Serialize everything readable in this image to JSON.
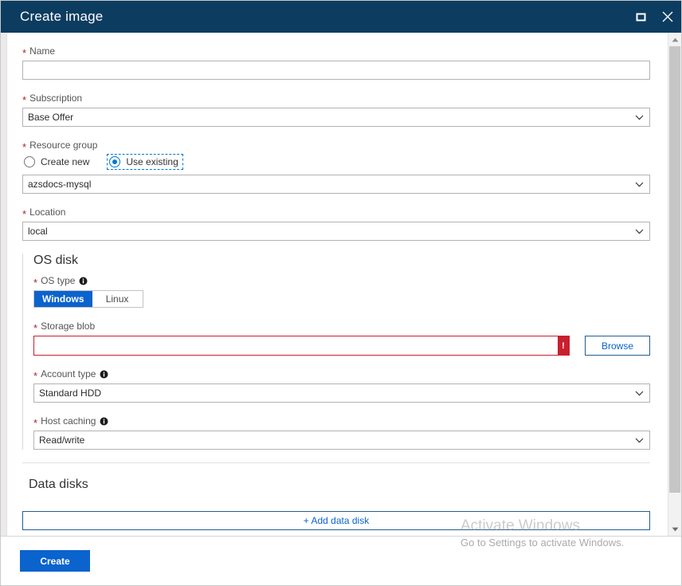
{
  "window": {
    "title": "Create image",
    "maximize_icon": "maximize-icon",
    "close_icon": "close-icon"
  },
  "form": {
    "name": {
      "label": "Name",
      "value": "",
      "required": true
    },
    "subscription": {
      "label": "Subscription",
      "value": "Base Offer",
      "required": true
    },
    "resource_group": {
      "label": "Resource group",
      "required": true,
      "options": [
        {
          "label": "Create new",
          "selected": false
        },
        {
          "label": "Use existing",
          "selected": true
        }
      ],
      "value": "azsdocs-mysql"
    },
    "location": {
      "label": "Location",
      "value": "local",
      "required": true
    }
  },
  "os_disk": {
    "title": "OS disk",
    "os_type": {
      "label": "OS type",
      "required": true,
      "info": "info-icon",
      "options": [
        {
          "label": "Windows",
          "selected": true
        },
        {
          "label": "Linux",
          "selected": false
        }
      ]
    },
    "storage_blob": {
      "label": "Storage blob",
      "required": true,
      "value": "",
      "error": "!",
      "browse_label": "Browse"
    },
    "account_type": {
      "label": "Account type",
      "required": true,
      "info": "info-icon",
      "value": "Standard HDD"
    },
    "host_caching": {
      "label": "Host caching",
      "required": true,
      "info": "info-icon",
      "value": "Read/write"
    }
  },
  "data_disks": {
    "title": "Data disks",
    "add_label": "+ Add data disk"
  },
  "footer": {
    "create_label": "Create"
  },
  "watermark": {
    "title": "Activate Windows",
    "subtitle": "Go to Settings to activate Windows."
  },
  "colors": {
    "titlebar": "#0c3c60",
    "accent": "#0b63ce",
    "required_asterisk": "#a4262c",
    "error": "#c8202e",
    "focus_outline": "#0078d4"
  }
}
